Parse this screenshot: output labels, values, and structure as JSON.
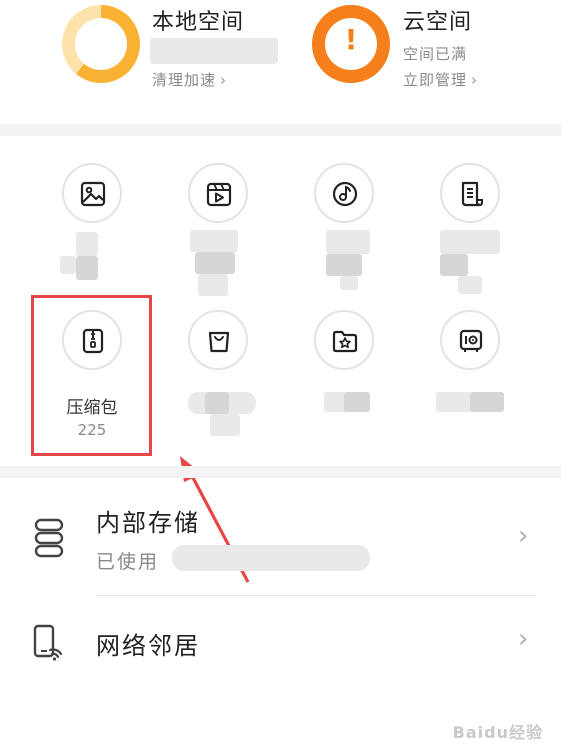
{
  "local_storage": {
    "title": "本地空间",
    "action": "清理加速",
    "ring_color": "#f9b233"
  },
  "cloud_storage": {
    "title": "云空间",
    "status": "空间已满",
    "action": "立即管理",
    "ring_color": "#f47f1b",
    "alert_icon": "!"
  },
  "categories": [
    {
      "icon": "image-icon"
    },
    {
      "icon": "video-icon"
    },
    {
      "icon": "music-icon"
    },
    {
      "icon": "document-icon"
    },
    {
      "icon": "zip-icon",
      "label": "压缩包",
      "count": "225"
    },
    {
      "icon": "bag-icon"
    },
    {
      "icon": "starred-folder-icon"
    },
    {
      "icon": "safe-icon"
    }
  ],
  "storage_rows": [
    {
      "icon": "storage-icon",
      "title": "内部存储",
      "subtitle": "已使用"
    },
    {
      "icon": "network-phone-icon",
      "title": "网络邻居"
    }
  ],
  "chevron": "›",
  "annotation": {
    "highlight_color": "#e64646"
  },
  "watermark": "Baidu经验"
}
